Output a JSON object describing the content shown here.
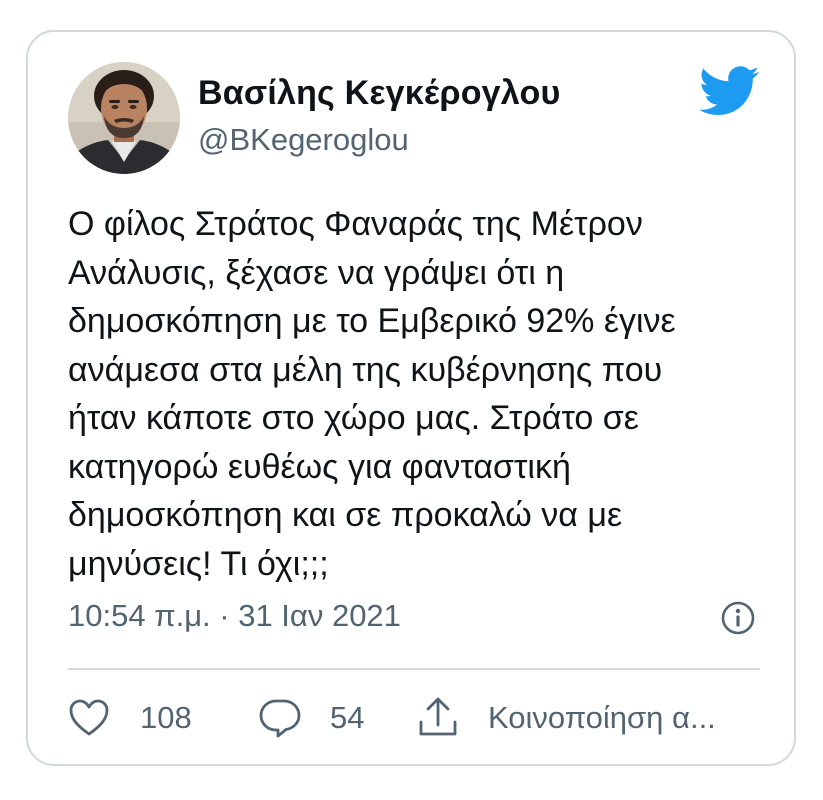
{
  "tweet": {
    "author": {
      "name": "Βασίλης Κεγκέρογλου",
      "handle": "@BKegeroglou"
    },
    "text_lines": [
      "Ο φίλος Στράτος Φαναράς της Μέτρον",
      "Ανάλυσις, ξέχασε να γράψει ότι η",
      "δημοσκόπηση με το Εμβερικό 92% έγινε",
      "ανάμεσα στα μέλη της κυβέρνησης που",
      "ήταν κάποτε στο χώρο μας. Στράτο σε",
      "κατηγορώ ευθέως για φανταστική",
      "δημοσκόπηση και σε προκαλώ να με",
      "μηνύσεις! Τι όχι;;;"
    ],
    "timestamp": "10:54 π.μ. · 31 Ιαν 2021",
    "likes": "108",
    "replies": "54",
    "share_label": "Κοινοποίηση α..."
  },
  "icons": {
    "brand": "twitter-bird",
    "info": "info-circle",
    "like": "heart-outline",
    "reply": "speech-bubble-outline",
    "share": "share-upload"
  },
  "colors": {
    "brand_blue": "#1d9bf0",
    "text_primary": "#0f1419",
    "text_secondary": "#536471",
    "border": "#cfd9de"
  }
}
